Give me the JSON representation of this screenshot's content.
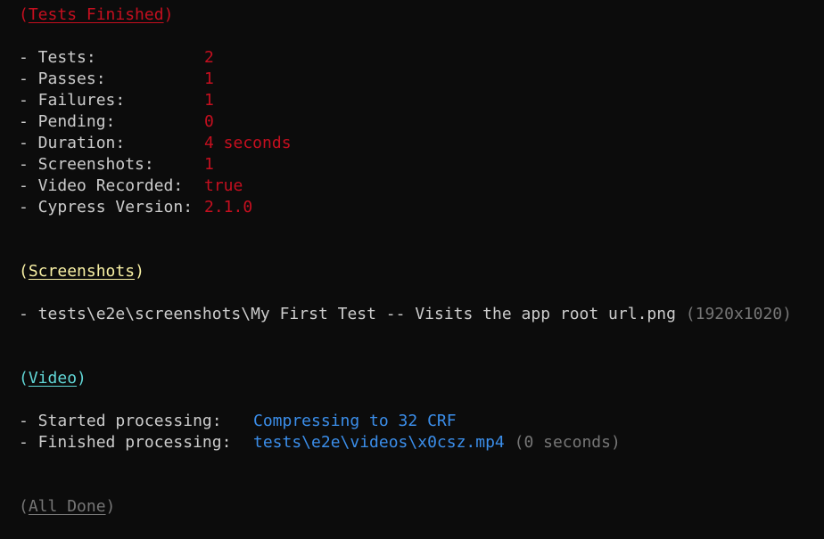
{
  "colors": {
    "background": "#0c0c0c",
    "text": "#cccccc",
    "red": "#c50f1f",
    "yellow": "#f9f1a5",
    "cyan": "#61d6d6",
    "blue": "#3b8eea",
    "gray": "#767676"
  },
  "tests_finished": {
    "header": "Tests Finished",
    "rows": [
      {
        "label": "- Tests:",
        "value": "2"
      },
      {
        "label": "- Passes:",
        "value": "1"
      },
      {
        "label": "- Failures:",
        "value": "1"
      },
      {
        "label": "- Pending:",
        "value": "0"
      },
      {
        "label": "- Duration:",
        "value": "4 seconds"
      },
      {
        "label": "- Screenshots:",
        "value": "1"
      },
      {
        "label": "- Video Recorded:",
        "value": "true"
      },
      {
        "label": "- Cypress Version:",
        "value": "2.1.0"
      }
    ]
  },
  "screenshots": {
    "header": "Screenshots",
    "items": [
      {
        "path": "- tests\\e2e\\screenshots\\My First Test -- Visits the app root url.png",
        "dims": "(1920x1020)"
      }
    ]
  },
  "video": {
    "header": "Video",
    "started_label": "- Started processing:",
    "started_value": "Compressing to 32 CRF",
    "finished_label": "- Finished processing:",
    "finished_value": "tests\\e2e\\videos\\x0csz.mp4",
    "finished_time": "(0 seconds)"
  },
  "done": {
    "header": "All Done"
  }
}
